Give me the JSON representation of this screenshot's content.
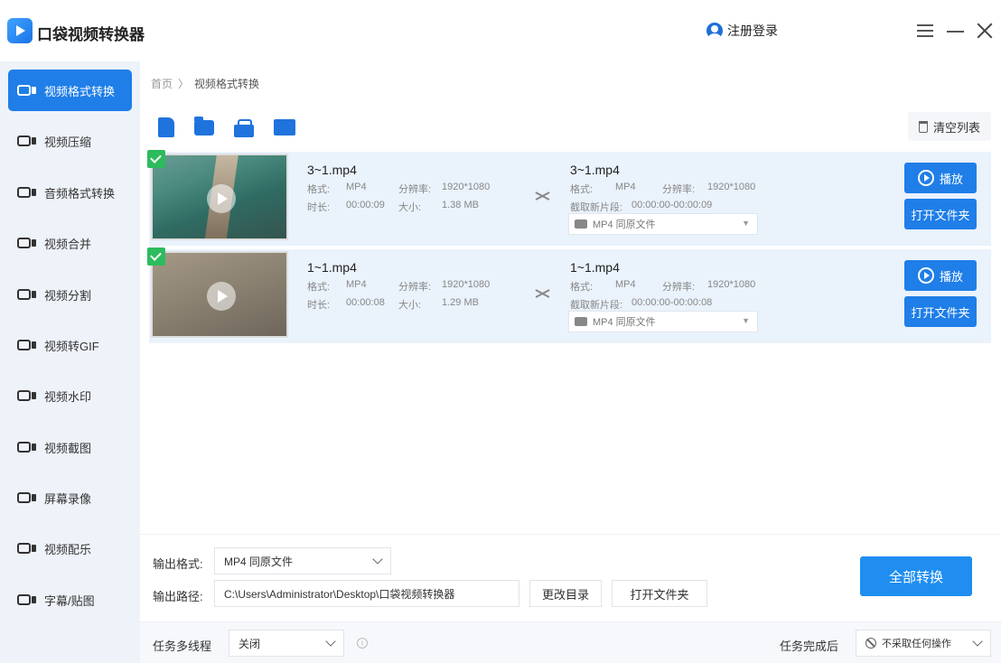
{
  "app": {
    "title": "口袋视频转换器",
    "login_label": "注册登录"
  },
  "colors": {
    "accent": "#1f7ee8",
    "check": "#2dbb5d"
  },
  "sidebar": {
    "items": [
      {
        "label": "视频格式转换",
        "icon": "video-convert-icon",
        "active": true
      },
      {
        "label": "视频压缩",
        "icon": "video-compress-icon"
      },
      {
        "label": "音频格式转换",
        "icon": "audio-convert-icon"
      },
      {
        "label": "视频合并",
        "icon": "video-merge-icon"
      },
      {
        "label": "视频分割",
        "icon": "video-split-icon"
      },
      {
        "label": "视频转GIF",
        "icon": "video-gif-icon"
      },
      {
        "label": "视频水印",
        "icon": "video-watermark-icon"
      },
      {
        "label": "视频截图",
        "icon": "video-screenshot-icon"
      },
      {
        "label": "屏幕录像",
        "icon": "screen-record-icon"
      },
      {
        "label": "视频配乐",
        "icon": "video-music-icon"
      },
      {
        "label": "字幕/贴图",
        "icon": "subtitle-sticker-icon"
      }
    ]
  },
  "breadcrumb": {
    "home": "首页",
    "sep": "〉",
    "current": "视频格式转换"
  },
  "toolbar": {
    "icons": [
      "add-file-icon",
      "add-folder-icon",
      "shop-icon",
      "monitor-icon"
    ],
    "clear_label": "清空列表"
  },
  "labels": {
    "format": "格式:",
    "resolution": "分辨率:",
    "duration": "时长:",
    "size": "大小:",
    "cut": "截取新片段:",
    "play": "播放",
    "open_folder": "打开文件夹"
  },
  "files": [
    {
      "src_name": "3~1.mp4",
      "src_format": "MP4",
      "src_resolution": "1920*1080",
      "src_duration": "00:00:09",
      "src_size": "1.38 MB",
      "out_name": "3~1.mp4",
      "out_format": "MP4",
      "out_resolution": "1920*1080",
      "cut_range": "00:00:00-00:00:09",
      "out_select": "MP4  同原文件"
    },
    {
      "src_name": "1~1.mp4",
      "src_format": "MP4",
      "src_resolution": "1920*1080",
      "src_duration": "00:00:08",
      "src_size": "1.29 MB",
      "out_name": "1~1.mp4",
      "out_format": "MP4",
      "out_resolution": "1920*1080",
      "cut_range": "00:00:00-00:00:08",
      "out_select": "MP4  同原文件"
    }
  ],
  "bottom": {
    "output_format_label": "输出格式:",
    "output_format_value": "MP4  同原文件",
    "output_path_label": "输出路径:",
    "output_path_value": "C:\\Users\\Administrator\\Desktop\\口袋视频转换器",
    "change_dir_label": "更改目录",
    "open_folder_label": "打开文件夹",
    "convert_all_label": "全部转换",
    "multithread_label": "任务多线程",
    "multithread_value": "关闭",
    "after_label": "任务完成后",
    "after_value": "不采取任何操作"
  }
}
